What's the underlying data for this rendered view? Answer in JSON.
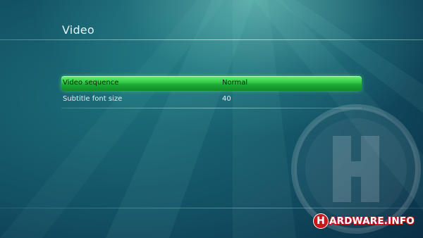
{
  "header": {
    "title": "Video"
  },
  "settings": {
    "items": [
      {
        "label": "Video sequence",
        "value": "Normal",
        "selected": true
      },
      {
        "label": "Subtitle font size",
        "value": "40",
        "selected": false
      }
    ]
  },
  "watermark": {
    "letter": "H",
    "brand_text": "ARDWARE.INFO"
  },
  "colors": {
    "selection": "#34cc47",
    "background": "#124f63",
    "brand_red": "#c8181e"
  }
}
